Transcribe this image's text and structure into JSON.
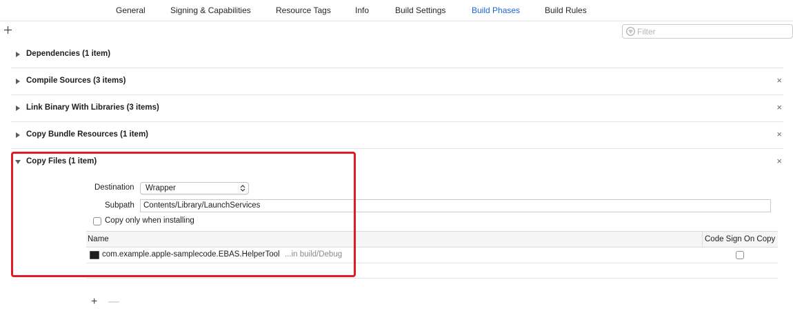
{
  "tabs": [
    {
      "label": "General",
      "active": false
    },
    {
      "label": "Signing & Capabilities",
      "active": false
    },
    {
      "label": "Resource Tags",
      "active": false
    },
    {
      "label": "Info",
      "active": false
    },
    {
      "label": "Build Settings",
      "active": false
    },
    {
      "label": "Build Phases",
      "active": true
    },
    {
      "label": "Build Rules",
      "active": false
    }
  ],
  "toolbar": {
    "add_icon": "plus-icon",
    "filter_placeholder": "Filter",
    "filter_icon": "filter-icon"
  },
  "phases": [
    {
      "title": "Dependencies (1 item)",
      "expanded": false,
      "removable": false
    },
    {
      "title": "Compile Sources (3 items)",
      "expanded": false,
      "removable": true
    },
    {
      "title": "Link Binary With Libraries (3 items)",
      "expanded": false,
      "removable": true
    },
    {
      "title": "Copy Bundle Resources (1 item)",
      "expanded": false,
      "removable": true
    },
    {
      "title": "Copy Files (1 item)",
      "expanded": true,
      "removable": true
    }
  ],
  "copy_files": {
    "destination_label": "Destination",
    "destination_value": "Wrapper",
    "subpath_label": "Subpath",
    "subpath_value": "Contents/Library/LaunchServices",
    "copy_only_label": "Copy only when installing",
    "copy_only_checked": false,
    "table": {
      "col_name": "Name",
      "col_code_sign": "Code Sign On Copy",
      "rows": [
        {
          "name": "com.example.apple-samplecode.EBAS.HelperTool",
          "location": "...in build/Debug",
          "code_sign": false,
          "icon": "executable-icon"
        }
      ]
    },
    "add_symbol": "+",
    "remove_symbol": "—"
  },
  "remove_symbol": "×",
  "colors": {
    "accent": "#1a66d8",
    "highlight": "#e11b22"
  }
}
